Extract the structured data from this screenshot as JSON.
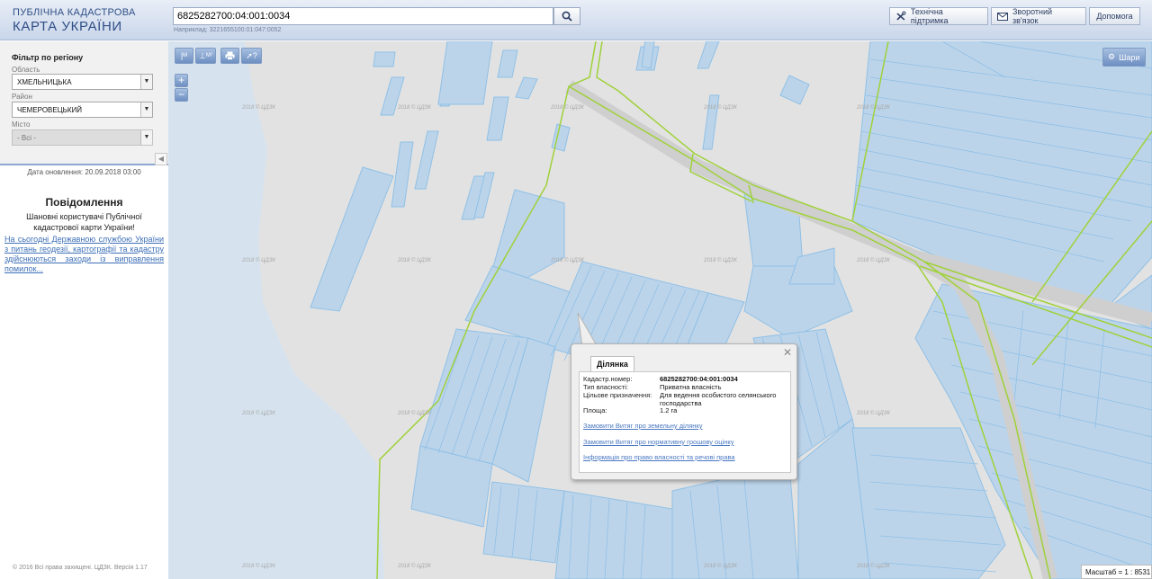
{
  "header": {
    "logo_line1": "ПУБЛІЧНА КАДАСТРОВА",
    "logo_line2": "КАРТА УКРАЇНИ",
    "search_value": "6825282700:04:001:0034",
    "search_hint": "Наприклад: 3221655100:01:047:0052",
    "buttons": {
      "support": "Технічна підтримка",
      "feedback": "Зворотний зв'язок",
      "help": "Допомога"
    }
  },
  "sidebar": {
    "filter_title": "Фільтр по регіону",
    "region_label": "Область",
    "region_value": "ХМЕЛЬНИЦЬКА",
    "district_label": "Район",
    "district_value": "ЧЕМЕРОВЕЦЬКИЙ",
    "city_label": "Місто",
    "city_value": "- Всі -",
    "updated": "Дата оновлення: 20.09.2018 03:00",
    "notice_title": "Повідомлення",
    "notice_body": "Шановні користувачі Публічної кадастрової карти України!",
    "notice_link": "На сьогодні Державною службою України з питань геодезії, картографії та кадастру здійснюються заходи із виправлення помилок...",
    "copyright": "© 2016 Всі права захищені. ЦДЗК. Версія 1.17"
  },
  "map": {
    "tools": {
      "measure": "M",
      "area": "M²",
      "info": "?"
    },
    "zoom_in": "+",
    "zoom_out": "−",
    "layers_label": "Шари",
    "scale_text": "Масштаб = 1 : 8531",
    "colors": {
      "parcel_fill": "#bcd4ea",
      "parcel_stroke": "#8fc0e6",
      "boundary": "#9fd13a",
      "background": "#e2e2e2",
      "water": "#d6e3ef"
    }
  },
  "popup": {
    "tab": "Ділянка",
    "fields": [
      {
        "label": "Кадастр.номер:",
        "value": "6825282700:04:001:0034"
      },
      {
        "label": "Тип власності:",
        "value": "Приватна власність"
      },
      {
        "label": "Цільове призначення:",
        "value": "Для ведення особистого селянського господарства"
      },
      {
        "label": "Площа:",
        "value": "1.2 га"
      }
    ],
    "links": [
      "Замовити Витяг про земельну ділянку",
      "Замовити Витяг про нормативну грошову оцінку",
      "Інформація про право власності та речові права"
    ]
  }
}
